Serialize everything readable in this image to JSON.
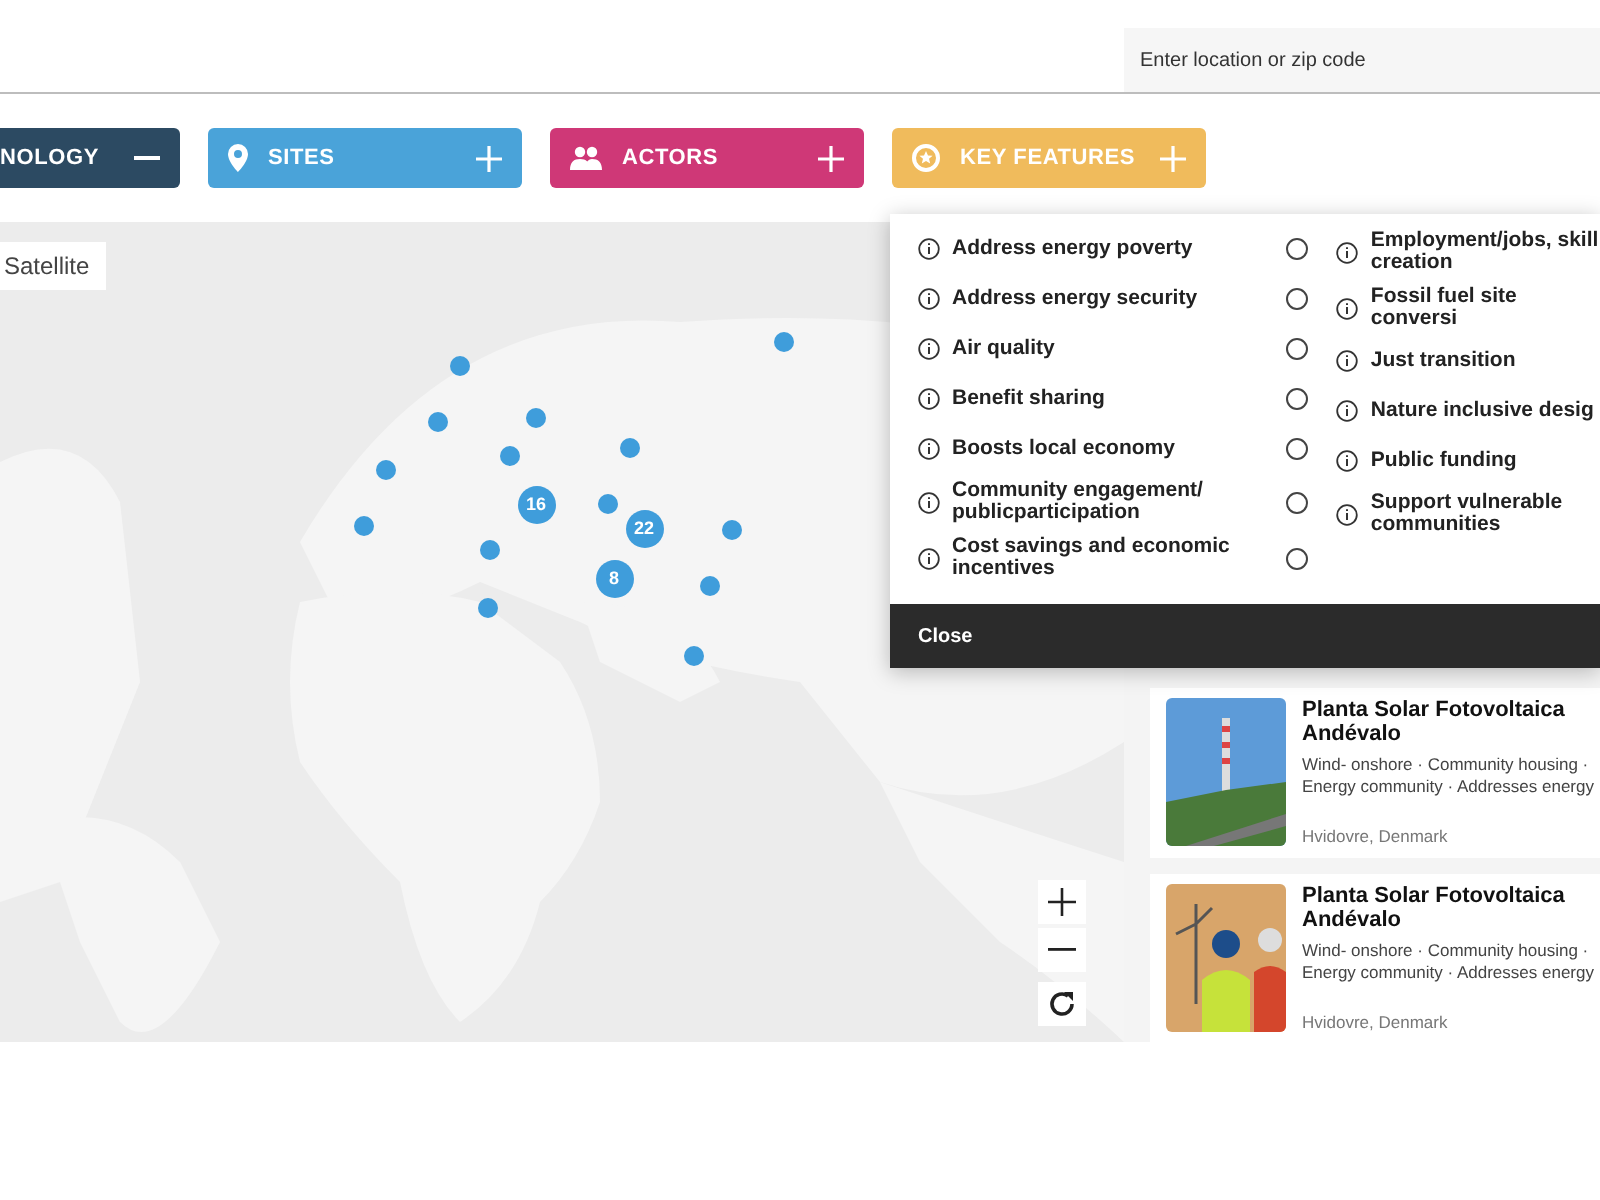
{
  "search": {
    "placeholder": "Enter location or zip code"
  },
  "filters": [
    {
      "label": "NOLOGY",
      "kind": "none",
      "color": "#2c4a62",
      "expanded": true
    },
    {
      "label": "SITES",
      "kind": "pin",
      "color": "#4aa3d9",
      "expanded": false
    },
    {
      "label": "ACTORS",
      "kind": "people",
      "color": "#cf3877",
      "expanded": false
    },
    {
      "label": "KEY FEATURES",
      "kind": "star",
      "color": "#f0bb5c",
      "expanded": false
    }
  ],
  "map": {
    "view_button": "Satellite",
    "clusters": [
      "16",
      "22",
      "8"
    ]
  },
  "key_features": {
    "left": [
      {
        "label": "Address energy poverty",
        "selected": false
      },
      {
        "label": "Address energy security",
        "selected": false
      },
      {
        "label": "Air quality",
        "selected": false
      },
      {
        "label": "Benefit sharing",
        "selected": false
      },
      {
        "label": "Boosts local economy",
        "selected": false
      },
      {
        "label": "Community engagement/ publicparticipation",
        "selected": false
      },
      {
        "label": "Cost savings and economic incentives",
        "selected": false
      }
    ],
    "right": [
      "Employment/jobs, skill creation",
      "Fossil fuel site conversi",
      "Just transition",
      "Nature inclusive desig",
      "Public funding",
      "Support vulnerable communities"
    ],
    "close": "Close"
  },
  "sites": [
    {
      "title": "Planta Solar Fotovoltaica Andévalo",
      "tags": "Wind- onshore · Community housing · Energy community · Addresses energy",
      "location": "Hvidovre, Denmark",
      "kind": "tower"
    },
    {
      "title": "Planta Solar Fotovoltaica Andévalo",
      "tags": "Wind- onshore · Community housing · Energy community · Addresses energy",
      "location": "Hvidovre, Denmark",
      "kind": "workers"
    }
  ]
}
